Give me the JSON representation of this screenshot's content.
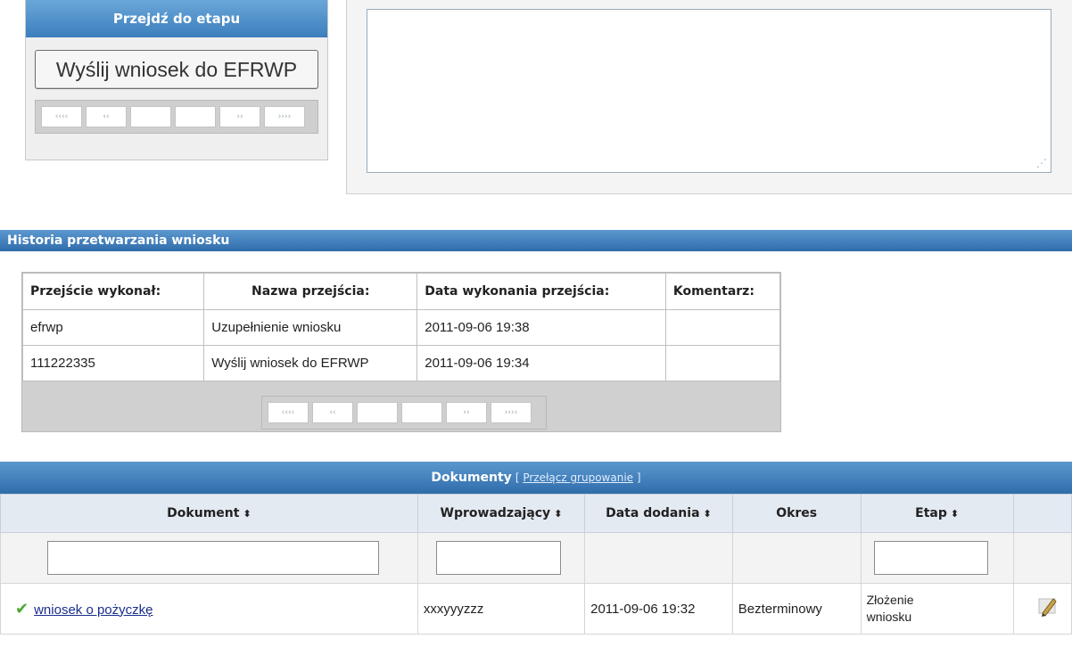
{
  "stage_panel": {
    "title": "Przejdź do etapu",
    "button_label": "Wyślij wniosek do EFRWP",
    "pager": [
      "‹‹‹‹",
      "‹‹",
      "",
      "",
      "››",
      "››››"
    ]
  },
  "history": {
    "title": "Historia przetwarzania wniosku",
    "columns": [
      "Przejście wykonał:",
      "Nazwa przejścia:",
      "Data wykonania przejścia:",
      "Komentarz:"
    ],
    "rows": [
      [
        "efrwp",
        "Uzupełnienie wniosku",
        "2011-09-06 19:38",
        ""
      ],
      [
        "111222335",
        "Wyślij wniosek do EFRWP",
        "2011-09-06 19:34",
        ""
      ]
    ],
    "pager": [
      "‹‹‹‹",
      "‹‹",
      "",
      "",
      "››",
      "››››"
    ]
  },
  "documents": {
    "title": "Dokumenty",
    "toggle_prefix": "[",
    "toggle_link": "Przełącz grupowanie",
    "toggle_suffix": "]",
    "columns": [
      {
        "label": "Dokument",
        "sortable": true
      },
      {
        "label": "Wprowadzający",
        "sortable": true
      },
      {
        "label": "Data dodania",
        "sortable": true
      },
      {
        "label": "Okres",
        "sortable": false
      },
      {
        "label": "Etap",
        "sortable": true
      },
      {
        "label": "",
        "sortable": false
      }
    ],
    "sort_icon": "⬍",
    "rows": [
      {
        "status_icon": "check-icon",
        "document": "wniosek o pożyczkę",
        "author": "xxxyyyzzz",
        "date": "2011-09-06 19:32",
        "period": "Bezterminowy",
        "stage": "Złożenie wniosku"
      }
    ]
  },
  "colors": {
    "header_blue": "#3c7fbd",
    "link": "#1a2d8c",
    "check": "#4aa832"
  }
}
